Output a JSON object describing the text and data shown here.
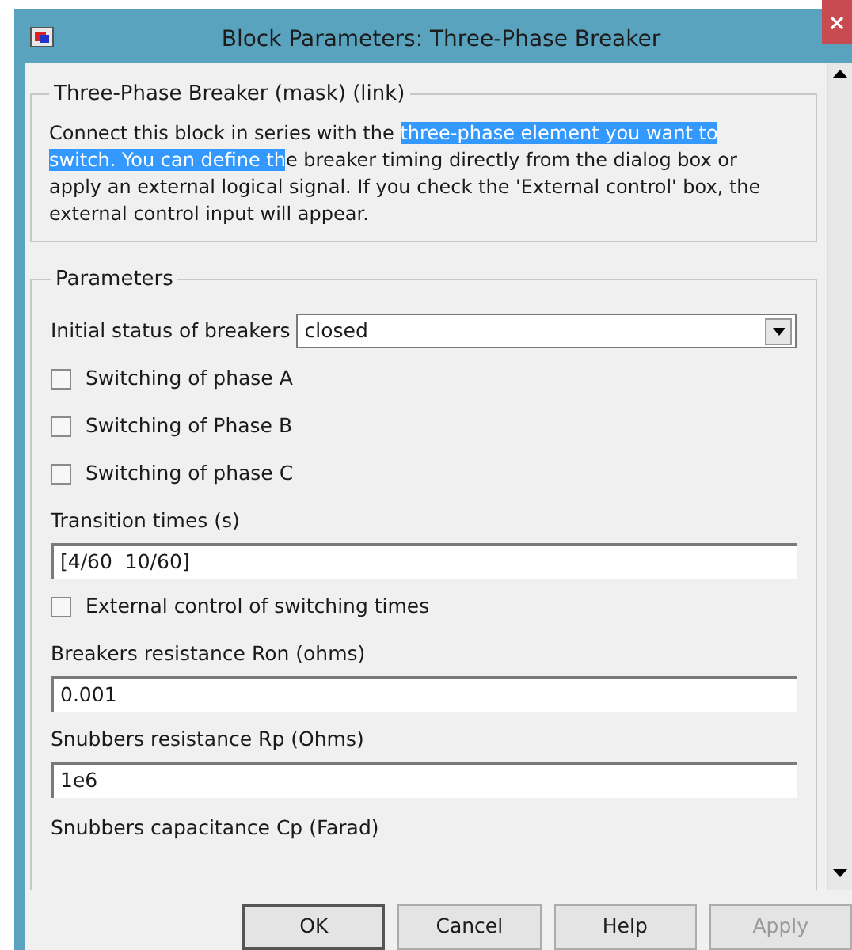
{
  "window": {
    "title": "Block Parameters: Three-Phase Breaker"
  },
  "description": {
    "title": "Three-Phase Breaker (mask) (link)",
    "segments": [
      {
        "text": "Connect this block in series with the ",
        "selected": false
      },
      {
        "text": "three-phase element you want to switch. You can define th",
        "selected": true
      },
      {
        "text": "e breaker timing directly from the dialog box or apply an external logical signal. If you check  the 'External control' box, the external control input will appear.",
        "selected": false
      }
    ]
  },
  "parameters": {
    "title": "Parameters",
    "items": [
      {
        "kind": "dropdown",
        "label": "Initial status of breakers",
        "value": "closed"
      },
      {
        "kind": "checkbox",
        "label": "Switching of phase A",
        "checked": false
      },
      {
        "kind": "checkbox",
        "label": "Switching of Phase B",
        "checked": false
      },
      {
        "kind": "checkbox",
        "label": "Switching of phase C",
        "checked": false
      },
      {
        "kind": "field",
        "label": "Transition times (s)",
        "value": "[4/60  10/60]"
      },
      {
        "kind": "checkbox",
        "label": "External control of switching times",
        "checked": false
      },
      {
        "kind": "field",
        "label": "Breakers resistance Ron (ohms)",
        "value": "0.001"
      },
      {
        "kind": "field",
        "label": "Snubbers resistance Rp (Ohms)",
        "value": "1e6"
      },
      {
        "kind": "label",
        "label": "Snubbers capacitance Cp (Farad)"
      }
    ]
  },
  "buttons": [
    {
      "label": "OK",
      "disabled": false
    },
    {
      "label": "Cancel",
      "disabled": false
    },
    {
      "label": "Help",
      "disabled": false
    },
    {
      "label": "Apply",
      "disabled": true
    }
  ]
}
